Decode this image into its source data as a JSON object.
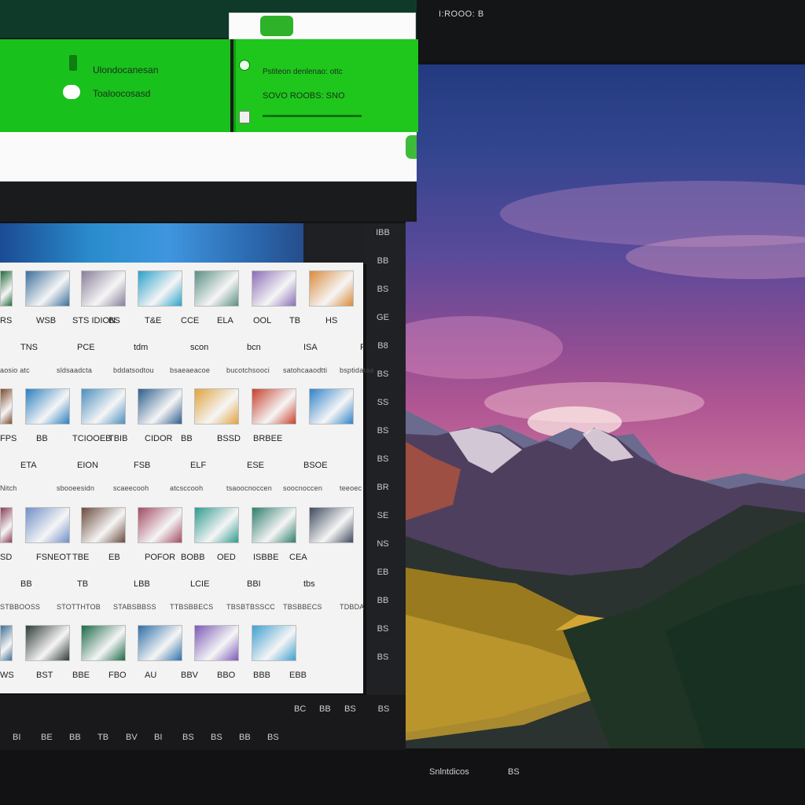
{
  "topbar": {
    "title": "I:ROOO: B"
  },
  "dialog": {
    "left_row1": "Ulondocanesan",
    "left_row2": "Toaloocosasd",
    "right_row1": "Pstiteon denlenao: ottc",
    "right_row2": "SOVO ROOBS: SNO",
    "colors": {
      "green": "#19c11d",
      "footer": "#fafafa"
    }
  },
  "gallery": {
    "rows": [
      {
        "thumbs": [
          "#1f6b3b",
          "#3b6f9c",
          "#8a7e9a",
          "#2aa1c9",
          "#5a8f84",
          "#8b6db7",
          "#d98b3b"
        ],
        "labels": [
          "RS",
          "WSB",
          "STS IDION",
          "BS",
          "T&E",
          "CCE",
          "ELA",
          "OOL",
          "TB",
          "HS"
        ],
        "row2": [
          "TNS",
          "PCE",
          "tdm",
          "scon",
          "bcn",
          "ISA",
          "Fdh",
          ""
        ],
        "row3": [
          "aosio atc",
          "sldsaadcta",
          "bddatsodtou",
          "bsaeaeacoe",
          "bucotchsooci",
          "satohcaaodtti",
          "bsptidataa"
        ]
      },
      {
        "thumbs": [
          "#7c4b2e",
          "#2a7fbf",
          "#4a8fbf",
          "#2c5d8e",
          "#e0a33e",
          "#c6412d",
          "#2f83c9"
        ],
        "labels": [
          "FPS",
          "BB",
          "TCIOOEB",
          "TBIB",
          "CIDOR",
          "BB",
          "BSSD",
          "BRBEE"
        ],
        "row2": [
          "ETA",
          "EION",
          "FSB",
          "ELF",
          "ESE",
          "BSOE",
          ""
        ],
        "row3": [
          "Nitch",
          "sbooeesidn",
          "scaeecooh",
          "atcsccooh",
          "tsaoocnoccen",
          "soocnoccen",
          "teeoec"
        ]
      },
      {
        "thumbs": [
          "#8a3d59",
          "#6f8fc7",
          "#6b4a3c",
          "#a34b63",
          "#2f9b8f",
          "#2f7d6d",
          "#3f4a5d"
        ],
        "labels": [
          "SD",
          "FSNEOT",
          "TBE",
          "EB",
          "POFOR",
          "BOBB",
          "OED",
          "ISBBE",
          "CEA"
        ],
        "row2": [
          "BB",
          "TB",
          "LBB",
          "LCIE",
          "BBI",
          "tbs",
          ""
        ],
        "row3": [
          "STBBOOSS",
          "STOTTHTOB",
          "STABSBBSS",
          "TTBSBBECS",
          "TBSBTBSSCC",
          "TBSBBECS",
          "TDBDA"
        ]
      },
      {
        "thumbs": [
          "#3d6f95",
          "#2f3b36",
          "#1b6a47",
          "#2d6fa8",
          "#7b5ab7",
          "#3f9fd0"
        ],
        "labels": [
          "WS",
          "BST",
          "BBE",
          "FBO",
          "AU",
          "BBV",
          "BBO",
          "BBB",
          "EBB"
        ],
        "row2": [],
        "row3": []
      }
    ],
    "sidebar_icons": [
      "IBB",
      "BB",
      "BS",
      "GE",
      "B8",
      "BS",
      "SS",
      "BS",
      "BS",
      "BR",
      "SE",
      "NS",
      "EB",
      "BB",
      "BS",
      "BS"
    ],
    "bottom_items": [
      "BI",
      "BE",
      "BB",
      "TB",
      "BV",
      "BI",
      "BS",
      "BS",
      "BB",
      "BS"
    ],
    "bottom_right": [
      "BC",
      "BB",
      "BS"
    ],
    "side_bottom": "BS"
  },
  "bottombar": {
    "label": "Snlntdicos",
    "mark": "BS"
  }
}
